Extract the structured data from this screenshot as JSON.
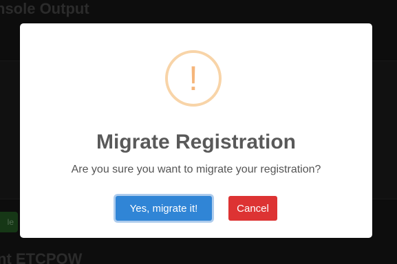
{
  "background": {
    "heading_top": "nsole Output",
    "green_button_label": "le",
    "heading_bottom": "nt ETCPOW"
  },
  "modal": {
    "icon": "warning-exclamation-icon",
    "icon_glyph": "!",
    "title": "Migrate Registration",
    "text": "Are you sure you want to migrate your registration?",
    "confirm_label": "Yes, migrate it!",
    "cancel_label": "Cancel"
  },
  "colors": {
    "confirm": "#3085d6",
    "cancel": "#dd3333",
    "warning": "#f8bb86"
  }
}
